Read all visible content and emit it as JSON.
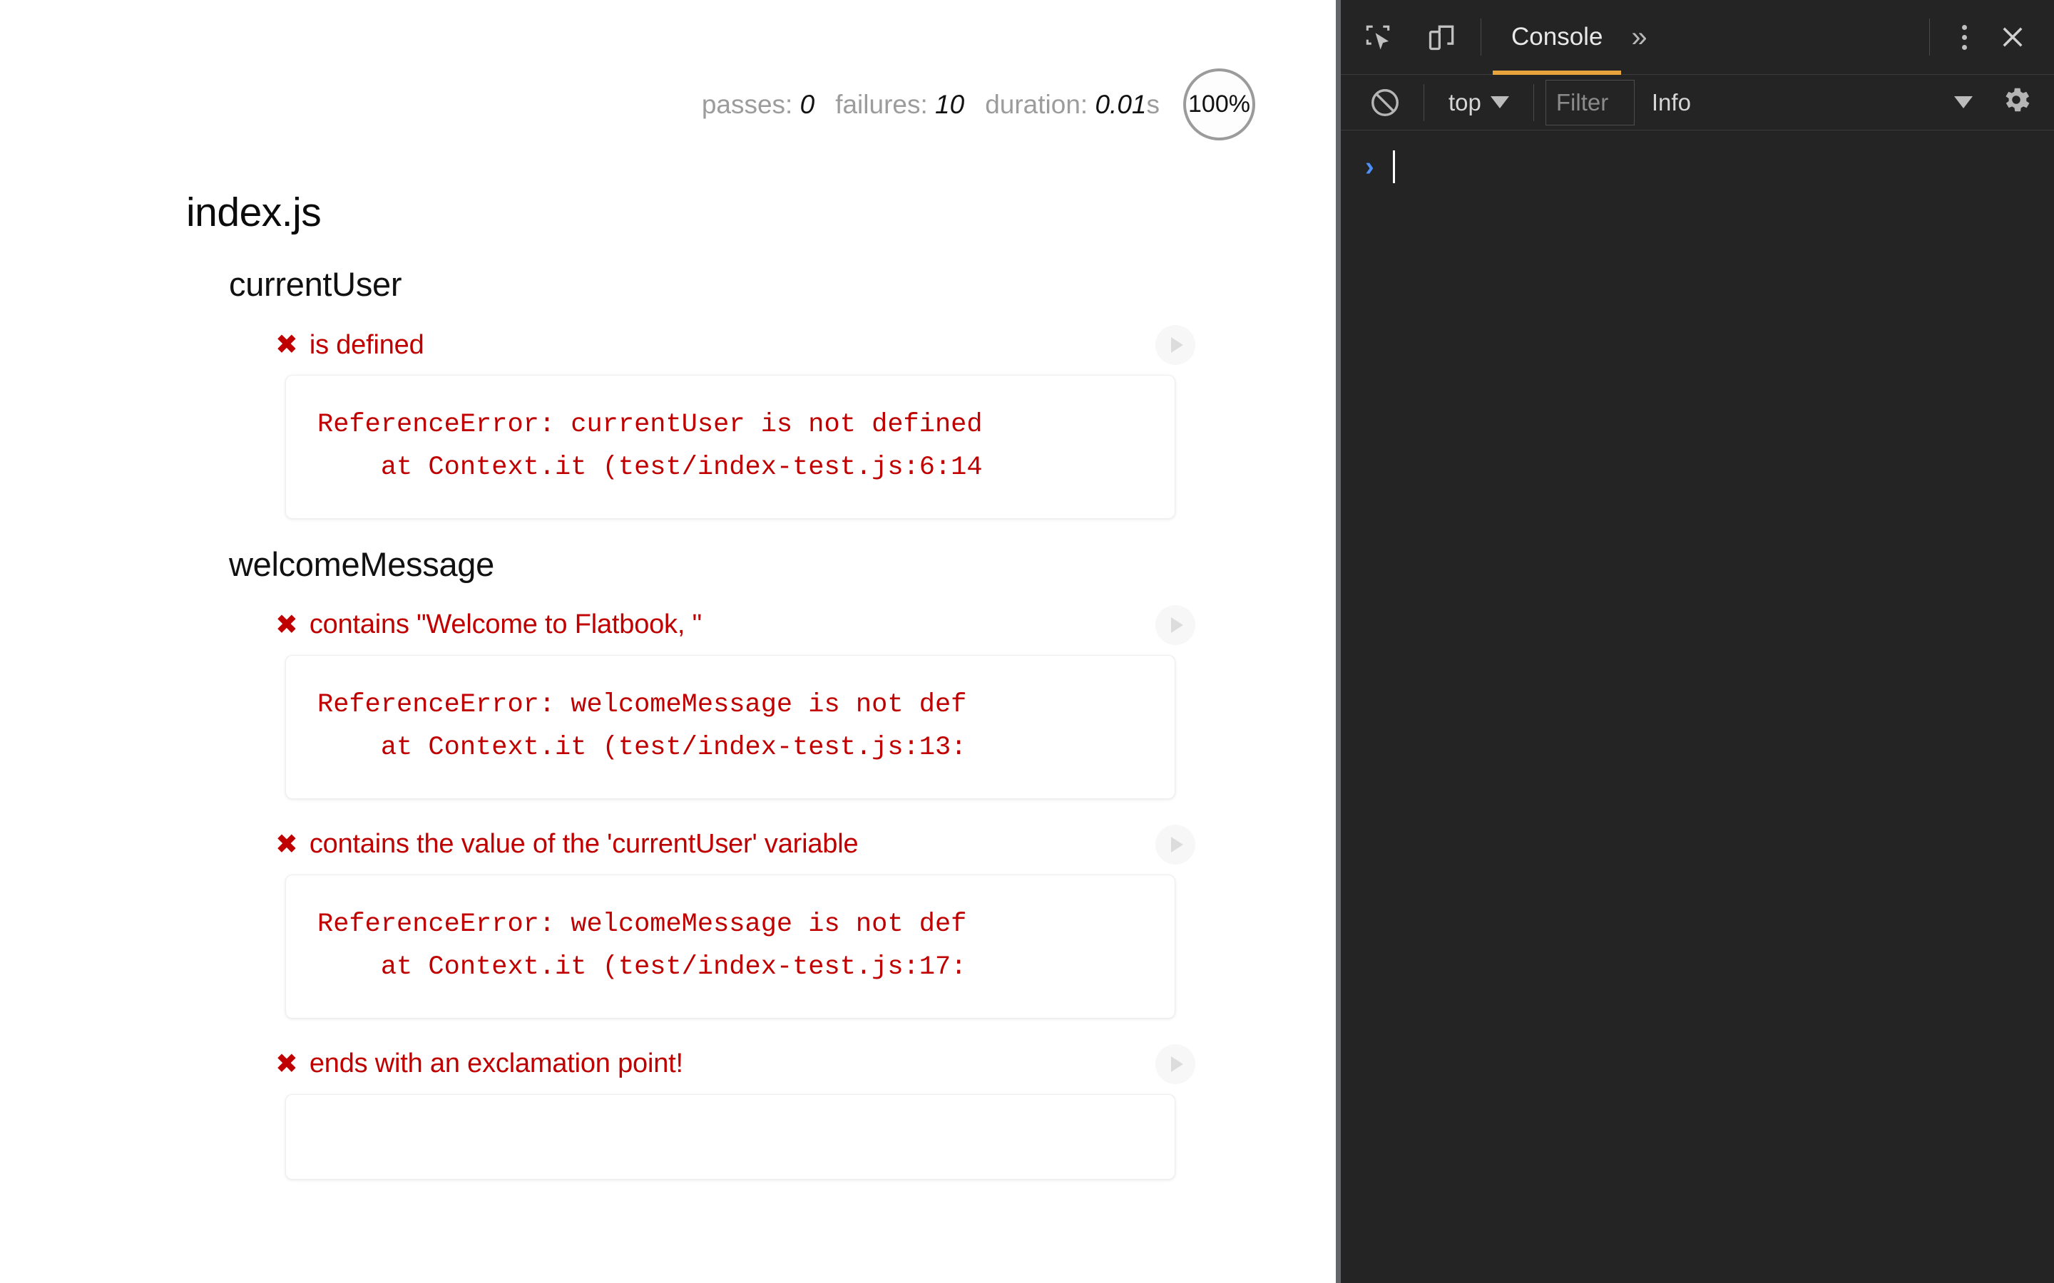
{
  "page": {
    "stats": {
      "passes_label": "passes:",
      "passes_value": "0",
      "failures_label": "failures:",
      "failures_value": "10",
      "duration_label": "duration:",
      "duration_value": "0.01",
      "duration_unit": "s",
      "progress": "100%"
    },
    "root_suite": "index.js",
    "suites": [
      {
        "title": "currentUser",
        "tests": [
          {
            "status_icon": "✖",
            "name": "is defined",
            "error": "ReferenceError: currentUser is not defined\n    at Context.it (test/index-test.js:6:14"
          }
        ]
      },
      {
        "title": "welcomeMessage",
        "tests": [
          {
            "status_icon": "✖",
            "name": "contains \"Welcome to Flatbook, \"",
            "error": "ReferenceError: welcomeMessage is not def\n    at Context.it (test/index-test.js:13:"
          },
          {
            "status_icon": "✖",
            "name": "contains the value of the 'currentUser' variable",
            "error": "ReferenceError: welcomeMessage is not def\n    at Context.it (test/index-test.js:17:"
          },
          {
            "status_icon": "✖",
            "name": "ends with an exclamation point!",
            "error": ""
          }
        ]
      }
    ]
  },
  "devtools": {
    "tabs": {
      "inspect_icon": "inspect-element-icon",
      "device_icon": "device-toolbar-icon",
      "active_tab": "Console",
      "more_tabs": "»",
      "kebab": "⋮",
      "close": "✕"
    },
    "console_toolbar": {
      "clear_icon": "🚫",
      "context": "top",
      "filter_placeholder": "Filter",
      "level": "Info",
      "settings_icon": "gear-icon"
    },
    "prompt": {
      "chevron": "›",
      "input_value": ""
    },
    "colors": {
      "accent": "#e8a33d",
      "panel_bg": "#242424",
      "prompt_blue": "#4d8ff5",
      "error_red": "#c00000"
    }
  }
}
